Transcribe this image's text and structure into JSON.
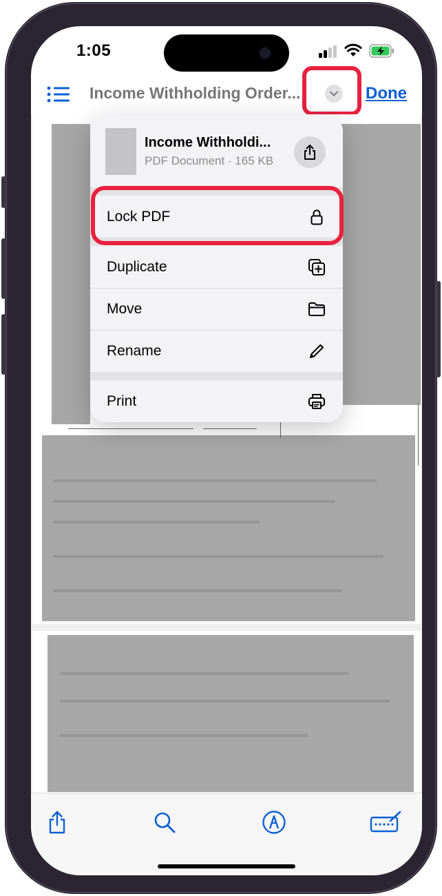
{
  "status_bar": {
    "time": "1:05"
  },
  "nav": {
    "title": "Income Withholding Order...",
    "done_label": "Done"
  },
  "menu": {
    "file_name": "Income Withholdi...",
    "file_meta": "PDF Document · 165 KB",
    "items": [
      {
        "label": "Lock PDF",
        "icon": "lock-icon"
      },
      {
        "label": "Duplicate",
        "icon": "duplicate-icon"
      },
      {
        "label": "Move",
        "icon": "folder-icon"
      },
      {
        "label": "Rename",
        "icon": "pencil-icon"
      },
      {
        "label": "Print",
        "icon": "printer-icon"
      }
    ]
  },
  "toolbar": {
    "icons": [
      "share-icon",
      "search-icon",
      "markup-icon",
      "keyboard-signature-icon"
    ]
  },
  "colors": {
    "accent_blue": "#0b5fd6",
    "highlight_red": "#e8213f"
  }
}
